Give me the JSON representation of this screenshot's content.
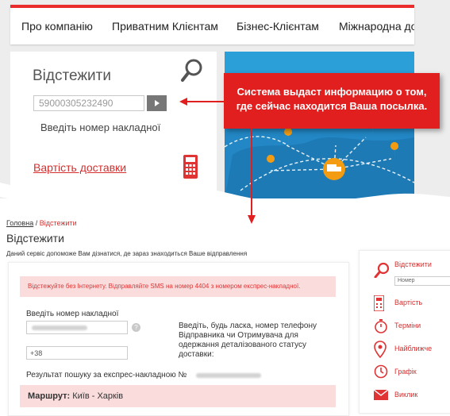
{
  "nav": {
    "items": [
      "Про компанію",
      "Приватним Клієнтам",
      "Бізнес-Клієнтам",
      "Міжнародна до"
    ]
  },
  "track_widget": {
    "title": "Відстежити",
    "input_value": "59000305232490",
    "hint": "Введіть номер накладної",
    "cost_link": "Вартість доставки"
  },
  "callout": {
    "line1": "Система выдаст информацию о том,",
    "line2": "где сейчас находится Ваша посылка."
  },
  "page": {
    "breadcrumb_home": "Головна",
    "breadcrumb_sep": " / ",
    "breadcrumb_current": "Відстежити",
    "title": "Відстежити",
    "description": "Даний сервіс допоможе Вам дізнатися, де зараз знаходиться Ваше відправлення"
  },
  "form": {
    "alert": "Відстежуйте без Інтернету. Відправляйте SMS на номер 4404 з номером експрес-накладної.",
    "label_number": "Введіть номер накладної",
    "help": "?",
    "phone_value": "+38",
    "phone_desc": "Введіть, будь ласка, номер телефону Відправника чи Отримувача для одержання деталізованого статусу доставки:",
    "result_label": "Результат пошуку за експрес-накладною №",
    "route_label": "Маршрут:",
    "route_value": " Київ - Харків"
  },
  "sidebar": {
    "items": [
      "Відстежити",
      "Вартість",
      "Терміни",
      "Найближче",
      "Графік",
      "Виклик"
    ],
    "mini_input": "Номер"
  },
  "colors": {
    "accent": "#e21f1f",
    "map": "#2a9fd8",
    "alert_bg": "#fadcdc"
  }
}
